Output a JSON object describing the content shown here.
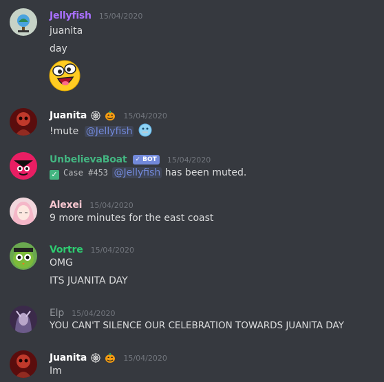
{
  "messages": [
    {
      "username": "Jellyfish",
      "timestamp": "15/04/2020",
      "name_color": "#a970ff",
      "lines": [
        "juanita",
        "day"
      ]
    },
    {
      "username": "Juanita",
      "timestamp": "15/04/2020",
      "name_color": "#ffffff",
      "command": "!mute",
      "mention": "@Jellyfish"
    },
    {
      "username": "UnbelievaBoat",
      "badge": "BOT",
      "timestamp": "15/04/2020",
      "name_color": "#43b581",
      "case": "Case #453",
      "mention": "@Jellyfish",
      "tail": "has been muted."
    },
    {
      "username": "Alexei",
      "timestamp": "15/04/2020",
      "name_color": "#f6c6cf",
      "lines": [
        "9 more minutes for the east coast"
      ]
    },
    {
      "username": "Vortre",
      "timestamp": "15/04/2020",
      "name_color": "#2ecc71",
      "lines": [
        "OMG",
        "ITS JUANITA DAY"
      ]
    },
    {
      "username": "Elp",
      "timestamp": "15/04/2020",
      "name_color": "#8e9297",
      "lines": [
        "YOU CAN'T SILENCE OUR CELEBRATION TOWARDS JUANITA DAY"
      ]
    },
    {
      "username": "Juanita",
      "timestamp": "15/04/2020",
      "name_color": "#ffffff",
      "lines": [
        "Im"
      ]
    }
  ]
}
